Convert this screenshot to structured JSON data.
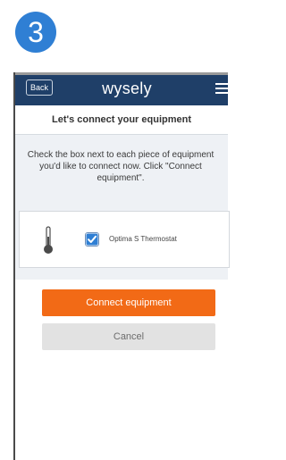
{
  "step": {
    "number": "3",
    "color": "#2f7fd4"
  },
  "header": {
    "back_label": "Back",
    "logo_text": "wysely",
    "background": "#1f3f68",
    "menu_icon": "hamburger-menu-icon"
  },
  "page": {
    "title": "Let's connect your equipment",
    "instructions": "Check the box next to each piece of equipment\nyou'd like to connect now. Click \"Connect\nequipment\"."
  },
  "equipment": [
    {
      "icon": "thermometer-icon",
      "label": "Optima S Thermostat",
      "checked": true
    }
  ],
  "actions": {
    "connect_label": "Connect equipment",
    "connect_color": "#f26a16",
    "cancel_label": "Cancel"
  }
}
